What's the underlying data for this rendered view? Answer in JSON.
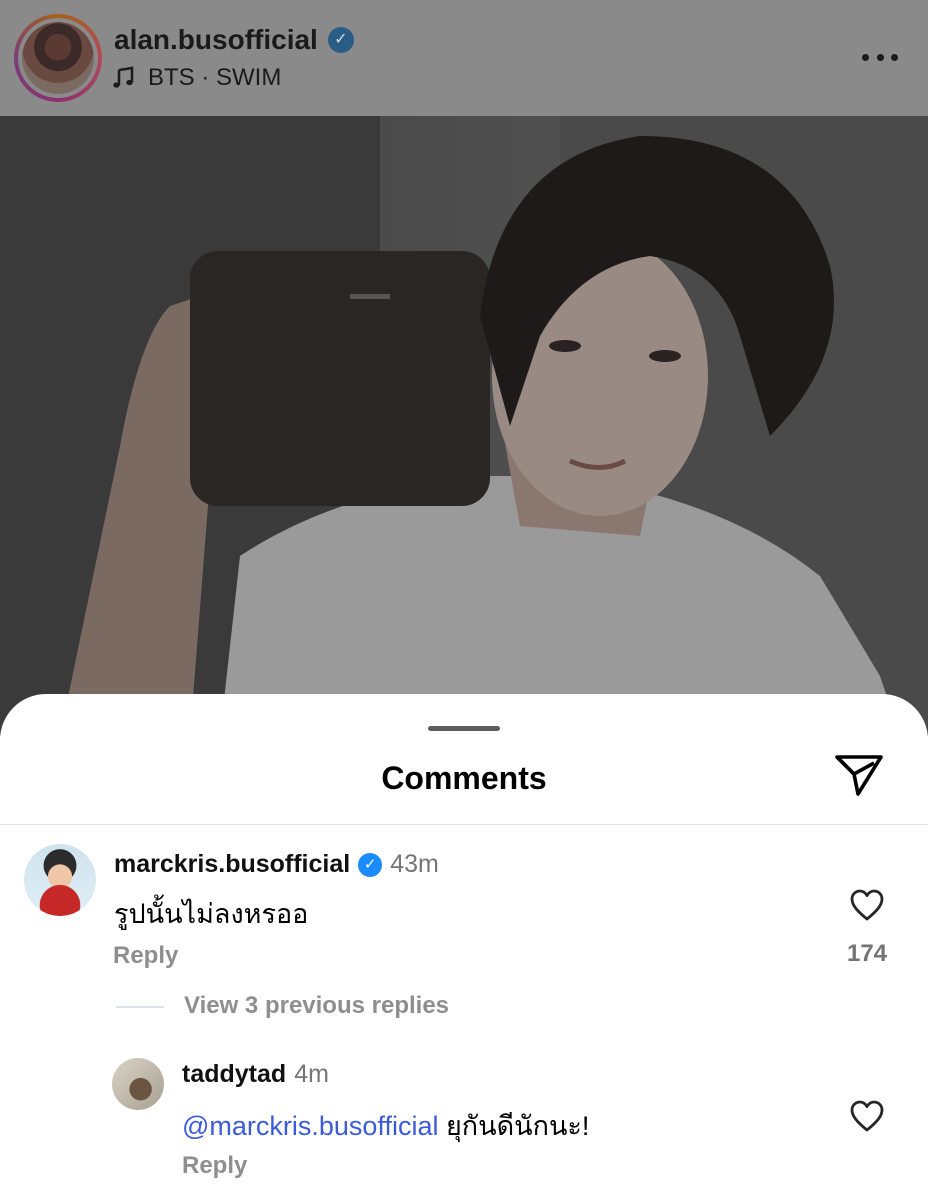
{
  "post": {
    "username": "alan.busofficial",
    "verified_icon": "verified-badge-icon",
    "music": "BTS · SWIM",
    "music_icon": "music-note-icon",
    "more_icon": "more-horizontal-icon"
  },
  "sheet": {
    "title": "Comments",
    "share_icon": "send-paper-plane-icon"
  },
  "comments": [
    {
      "username": "marckris.busofficial",
      "verified": true,
      "time": "43m",
      "text": "รูปนั้นไม่ลงหรออ",
      "reply_label": "Reply",
      "likes": "174",
      "view_replies": "View 3 previous replies"
    },
    {
      "username": "taddytad",
      "verified": false,
      "time": "4m",
      "mention": "@marckris.busofficial",
      "text": " ยุกันดีนักนะ!",
      "reply_label": "Reply"
    }
  ],
  "colors": {
    "mention": "#3b5bdb",
    "verified": "#1a8cff",
    "secondary_text": "#8e8e8e"
  }
}
